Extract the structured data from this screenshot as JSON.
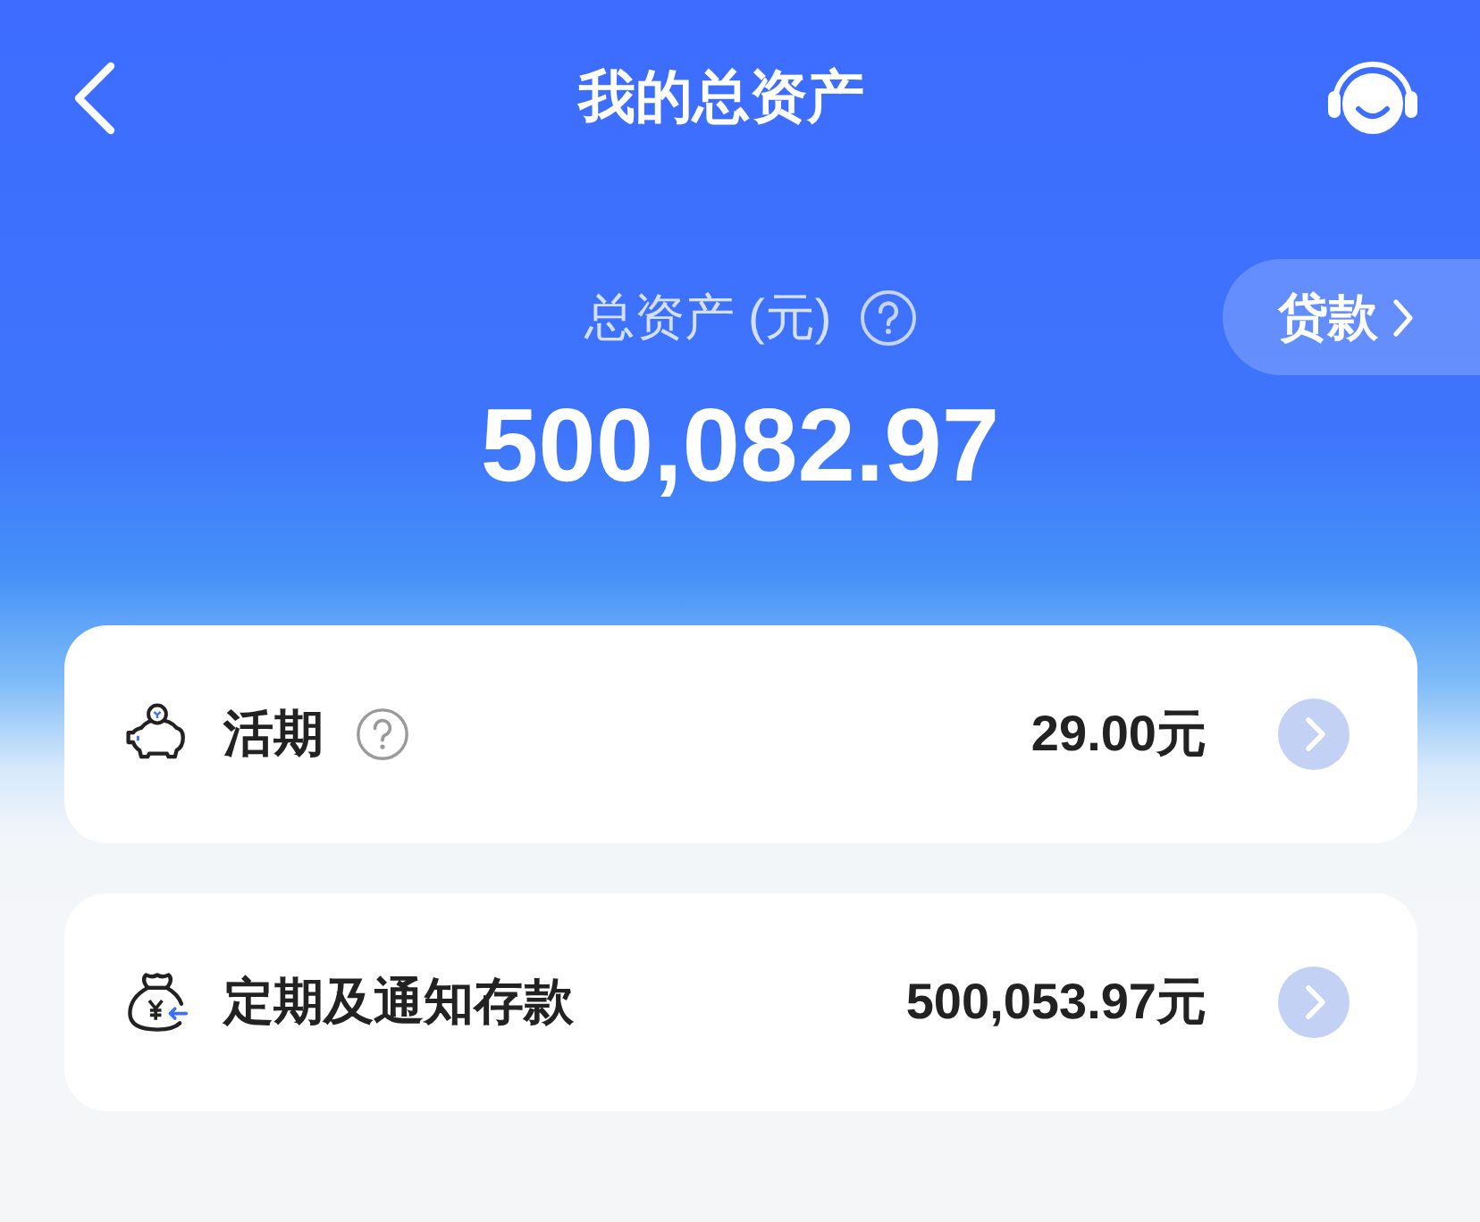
{
  "header": {
    "title": "我的总资产"
  },
  "summary": {
    "label": "总资产 (元)",
    "amount": "500,082.97"
  },
  "loan_button": {
    "label": "贷款"
  },
  "accounts": [
    {
      "kind": "demand",
      "name": "活期",
      "help": true,
      "amount": "29.00元"
    },
    {
      "kind": "term",
      "name": "定期及通知存款",
      "help": false,
      "amount": "500,053.97元"
    }
  ]
}
